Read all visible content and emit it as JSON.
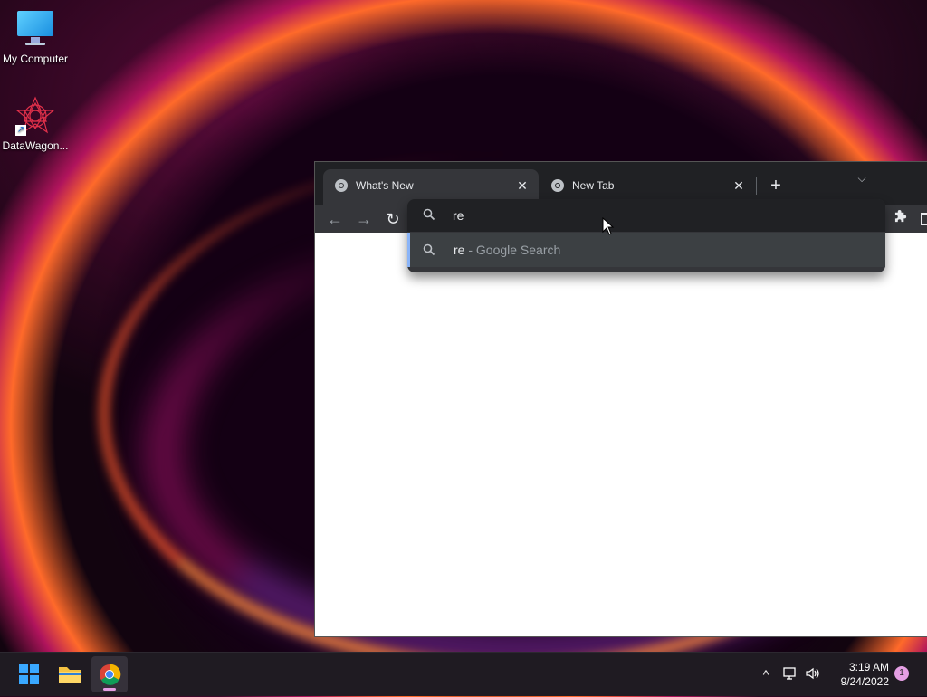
{
  "desktop": {
    "icons": [
      {
        "label": "My Computer"
      },
      {
        "label": "DataWagon..."
      }
    ]
  },
  "browser": {
    "tabs": [
      {
        "title": "What's New",
        "active": true
      },
      {
        "title": "New Tab",
        "active": false
      }
    ],
    "tab_close_glyph": "✕",
    "new_tab_glyph": "+",
    "tab_list_glyph": "⌵",
    "minimize_glyph": "—",
    "nav": {
      "back": "←",
      "forward": "→",
      "reload": "↻"
    },
    "omnibox": {
      "typed": "re",
      "suggestion": {
        "query": "re",
        "suffix": " - Google Search"
      }
    },
    "extensions_icon": "puzzle-icon"
  },
  "taskbar": {
    "apps": [
      "start-button",
      "file-explorer",
      "chrome"
    ],
    "tray": {
      "overflow": "^",
      "network": "network-icon",
      "volume": "volume-icon"
    },
    "clock": {
      "time": "3:19 AM",
      "date": "9/24/2022"
    },
    "notifications": "1"
  }
}
